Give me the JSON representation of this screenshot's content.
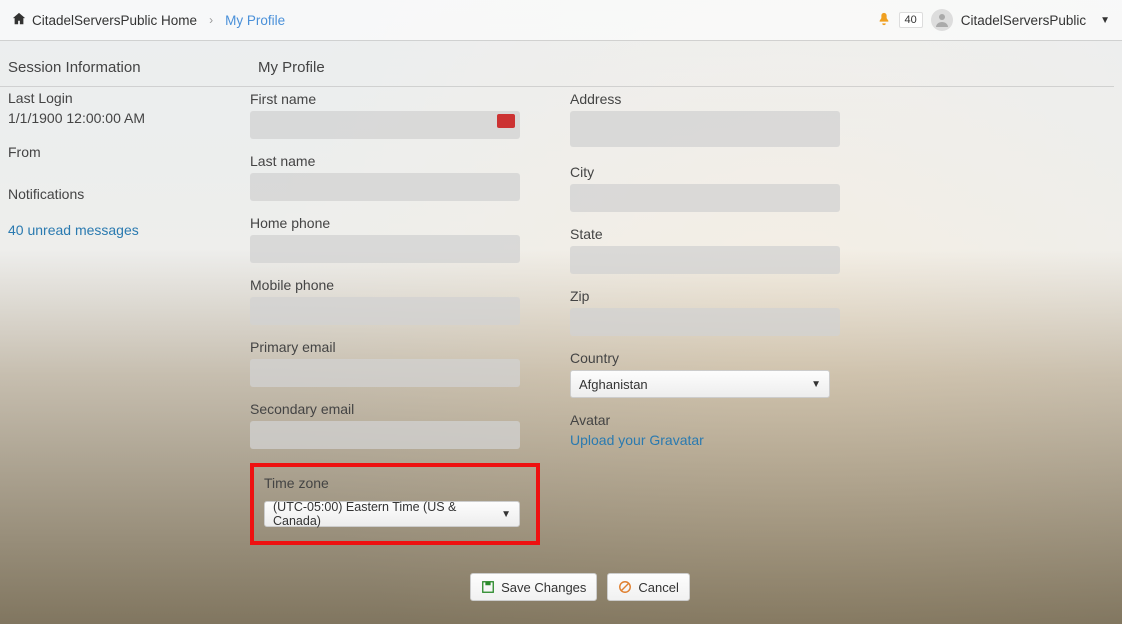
{
  "topbar": {
    "home_label": "CitadelServersPublic Home",
    "breadcrumb_current": "My Profile",
    "notification_count": "40",
    "username": "CitadelServersPublic"
  },
  "sidebar": {
    "session_title": "Session Information",
    "last_login_label": "Last Login",
    "last_login_value": "1/1/1900 12:00:00 AM",
    "from_label": "From",
    "from_value": "",
    "notifications_title": "Notifications",
    "unread_link": "40 unread messages"
  },
  "profile": {
    "title": "My Profile",
    "first_name_label": "First name",
    "first_name_value": "",
    "last_name_label": "Last name",
    "last_name_value": "",
    "home_phone_label": "Home phone",
    "home_phone_value": "",
    "mobile_phone_label": "Mobile phone",
    "mobile_phone_value": "",
    "primary_email_label": "Primary email",
    "primary_email_value": "",
    "secondary_email_label": "Secondary email",
    "secondary_email_value": "",
    "timezone_label": "Time zone",
    "timezone_value": "(UTC-05:00) Eastern Time (US & Canada)",
    "address_label": "Address",
    "address_value": "",
    "city_label": "City",
    "city_value": "",
    "state_label": "State",
    "state_value": "",
    "zip_label": "Zip",
    "zip_value": "",
    "country_label": "Country",
    "country_value": "Afghanistan",
    "avatar_label": "Avatar",
    "gravatar_link": "Upload your Gravatar"
  },
  "buttons": {
    "save_label": "Save Changes",
    "cancel_label": "Cancel"
  }
}
